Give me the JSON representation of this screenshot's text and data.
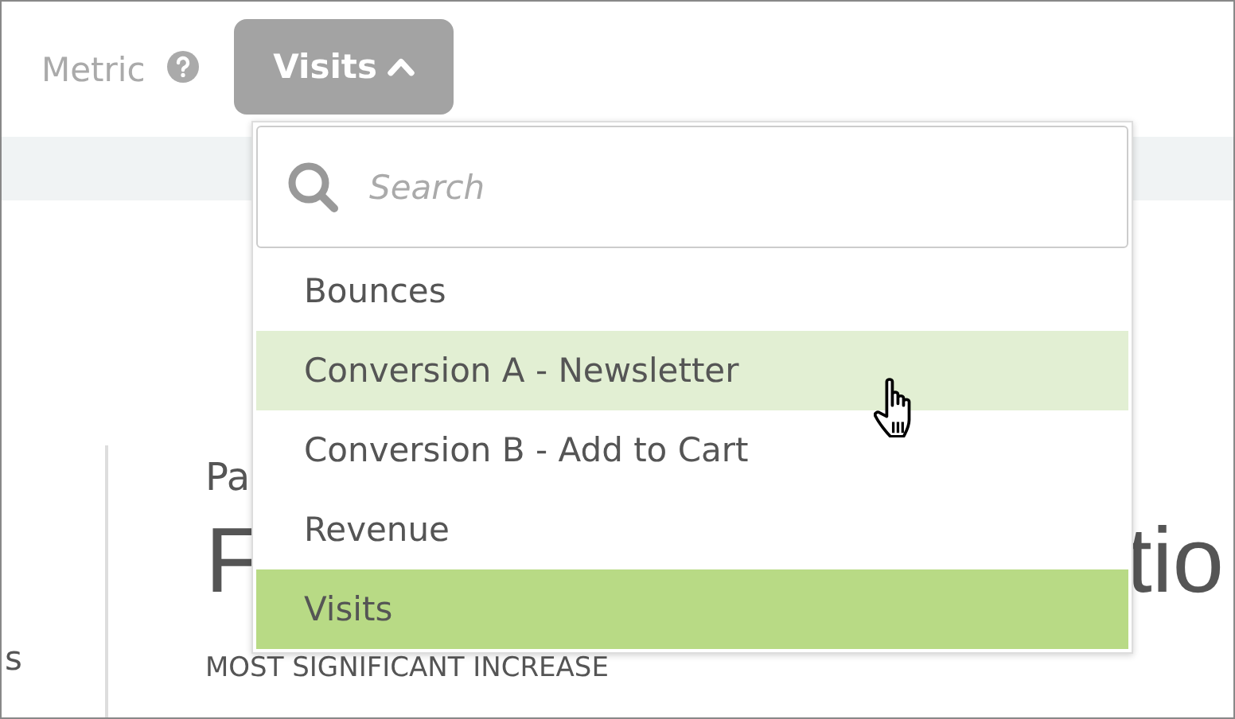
{
  "metric": {
    "label": "Metric",
    "button": "Visits",
    "expanded": true
  },
  "dropdown": {
    "search": {
      "placeholder": "Search"
    },
    "options": [
      {
        "label": "Bounces",
        "selected": false,
        "hovered": false
      },
      {
        "label": "Conversion A - Newsletter",
        "selected": false,
        "hovered": true
      },
      {
        "label": "Conversion B - Add to Cart",
        "selected": false,
        "hovered": false
      },
      {
        "label": "Revenue",
        "selected": false,
        "hovered": false
      },
      {
        "label": "Visits",
        "selected": true,
        "hovered": false
      }
    ]
  },
  "background": {
    "side_text": "s",
    "subtitle": "Pa",
    "title_start": "F",
    "title_end": "tio",
    "caption": "MOST SIGNIFICANT INCREASE"
  }
}
